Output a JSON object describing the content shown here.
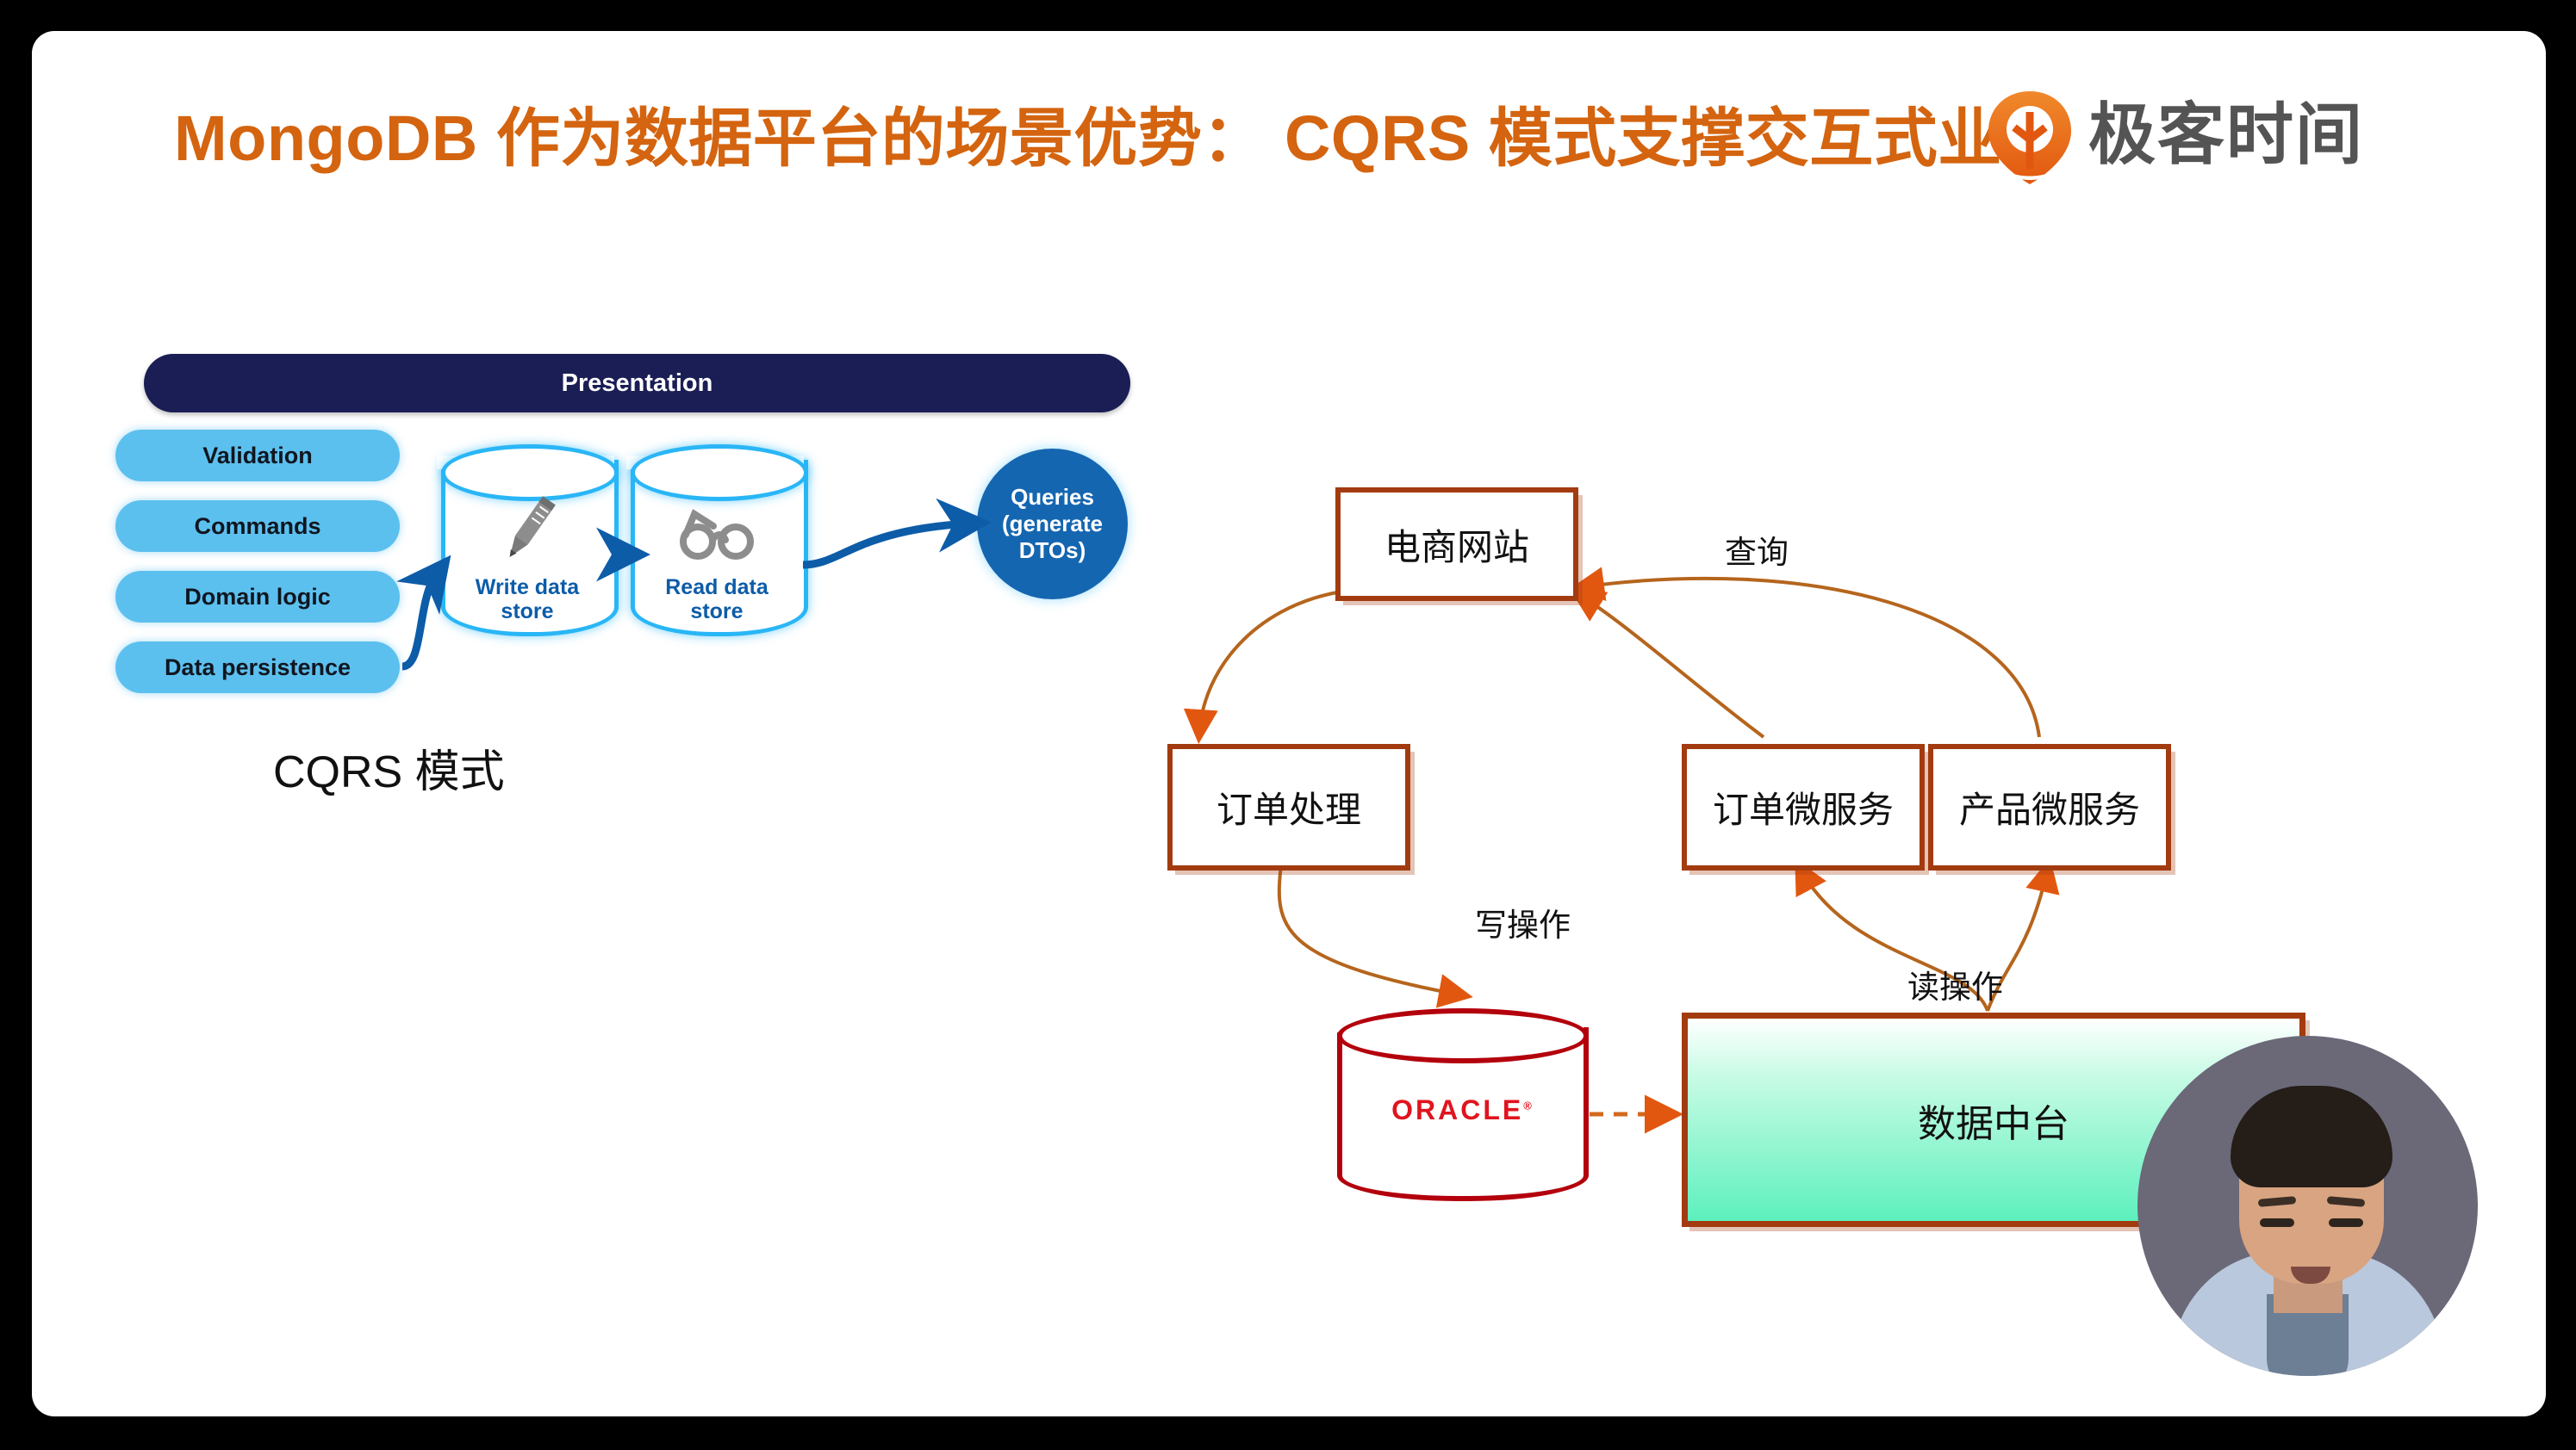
{
  "slide": {
    "title": "MongoDB 作为数据平台的场景优势： CQRS 模式支撑交互式业务",
    "title_color": "#d4640f",
    "background": "#ffffff"
  },
  "brand": {
    "logo_text": "极客时间",
    "logo_icon": "geektime-pin-icon",
    "logo_color": "#e8701a",
    "text_color": "#545454"
  },
  "cqrs_figure": {
    "caption": "CQRS 模式",
    "presentation_label": "Presentation",
    "presentation_color": "#1b1e55",
    "pill_color": "#5cc0ef",
    "pills": [
      {
        "label": "Validation"
      },
      {
        "label": "Commands"
      },
      {
        "label": "Domain logic"
      },
      {
        "label": "Data persistence"
      }
    ],
    "stores": [
      {
        "name": "write-data-store",
        "label": "Write data\nstore",
        "line1": "Write data",
        "line2": "store",
        "icon": "pencil-icon"
      },
      {
        "name": "read-data-store",
        "label": "Read data\nstore",
        "line1": "Read data",
        "line2": "store",
        "icon": "glasses-icon"
      }
    ],
    "store_color": "#29b6f6",
    "store_text_color": "#0d5ca8",
    "queries_node": {
      "line1": "Queries",
      "line2": "(generate",
      "line3": "DTOs)",
      "color": "#1566b0"
    }
  },
  "architecture": {
    "accent_color": "#a33b10",
    "arrow_color": "#d2691e",
    "boxes": [
      {
        "name": "ecommerce-site",
        "label": "电商网站"
      },
      {
        "name": "order-processing",
        "label": "订单处理"
      },
      {
        "name": "order-microservice",
        "label": "订单微服务"
      },
      {
        "name": "product-microservice",
        "label": "产品微服务"
      }
    ],
    "data_platform": {
      "label": "数据中台",
      "fill_top": "#ffffff",
      "fill_bottom": "#5df0bd"
    },
    "database": {
      "name": "oracle-database",
      "label": "ORACLE",
      "trademark": "®",
      "color": "#b3000c"
    },
    "edge_labels": [
      {
        "name": "query-label",
        "label": "查询"
      },
      {
        "name": "write-op-label",
        "label": "写操作"
      },
      {
        "name": "read-op-label",
        "label": "读操作"
      }
    ]
  },
  "webcam": {
    "name": "presenter-video",
    "alt": "presenter"
  }
}
